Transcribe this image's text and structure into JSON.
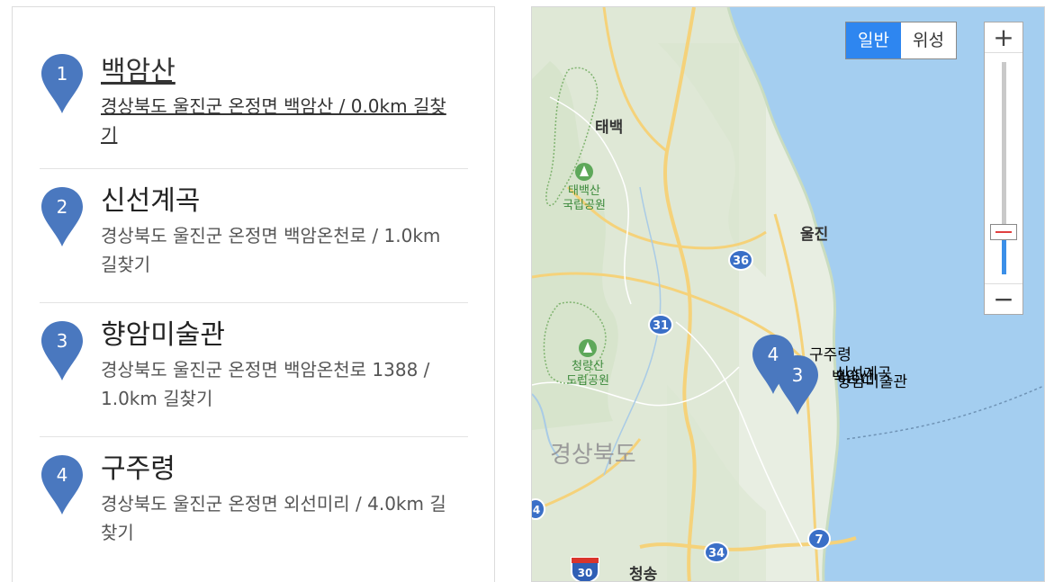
{
  "places": [
    {
      "num": "1",
      "name": "백암산",
      "address": "경상북도 울진군 온정면 백암산 / 0.0km 길찾기"
    },
    {
      "num": "2",
      "name": "신선계곡",
      "address": "경상북도 울진군 온정면 백암온천로 / 1.0km 길찾기"
    },
    {
      "num": "3",
      "name": "향암미술관",
      "address": "경상북도 울진군 온정면 백암온천로 1388 / 1.0km 길찾기"
    },
    {
      "num": "4",
      "name": "구주령",
      "address": "경상북도 울진군 온정면 외선미리 / 4.0km 길찾기"
    }
  ],
  "map": {
    "type_toggle": {
      "normal": "일반",
      "satellite": "위성",
      "selected": "normal"
    },
    "zoom": {
      "in_label": "+",
      "out_label": "−",
      "level_fraction": 0.2
    },
    "labels": {
      "taebaek": "태백",
      "taebaeksan": "태백산",
      "national_park": "국립공원",
      "uljin": "울진",
      "cheongnyangsan": "청량산",
      "provincial_park": "도립공원",
      "gyeongbuk": "경상북도",
      "cheongsong": "청송"
    },
    "road_shields": {
      "r36": "36",
      "r31": "31",
      "r34": "34",
      "r7": "7",
      "r4": "4",
      "r30": "30"
    },
    "marker_labels": {
      "m4": "구주령",
      "m2": "신선계곡",
      "m1": "백암산",
      "m3": "향암미술관"
    },
    "markers": [
      {
        "num": "4"
      },
      {
        "num": "3"
      }
    ]
  },
  "colors": {
    "pin": "#4a78bf",
    "accent": "#2e86f0",
    "sea": "#a4cef0"
  }
}
